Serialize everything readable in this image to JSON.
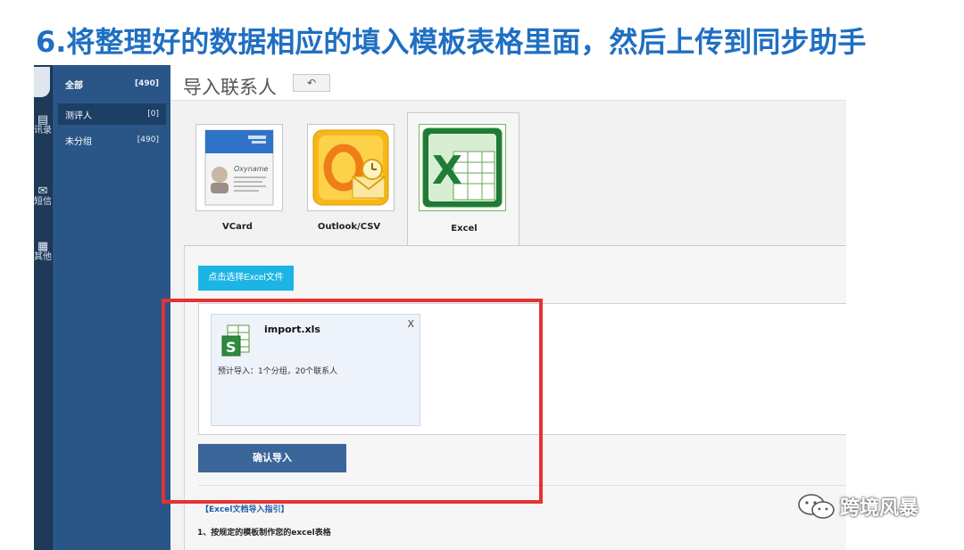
{
  "slide": {
    "title": "6.将整理好的数据相应的填入模板表格里面，然后上传到同步助手"
  },
  "nav": {
    "items": [
      {
        "icon": "contacts-book-icon",
        "label": "讯录"
      },
      {
        "icon": "mail-icon",
        "label": "短信"
      },
      {
        "icon": "grid-icon",
        "label": "其他"
      }
    ]
  },
  "groups": [
    {
      "label": "全部",
      "count": "[490]"
    },
    {
      "label": "测评人",
      "count": "[0]"
    },
    {
      "label": "未分组",
      "count": "[490]"
    }
  ],
  "header": {
    "title": "导入联系人",
    "back_icon": "undo-arrow-icon"
  },
  "tabs": [
    {
      "label": "VCard",
      "icon": "vcard-icon"
    },
    {
      "label": "Outlook/CSV",
      "icon": "outlook-icon"
    },
    {
      "label": "Excel",
      "icon": "excel-icon"
    }
  ],
  "vcard_card_name": "Oxyname",
  "selected_tab": "Excel",
  "content": {
    "choose_button": "点击选择Excel文件",
    "file": {
      "name": "import.xls",
      "close": "X",
      "summary": "预计导入：1个分组，20个联系人"
    },
    "confirm_button": "确认导入",
    "guide_title": "【Excel文档导入指引】",
    "guide_step": "1、按规定的模板制作您的excel表格"
  },
  "watermark": {
    "text": "跨境风暴"
  },
  "colors": {
    "title_blue": "#1f6fc2",
    "sidebar": "#2a5687",
    "choose_button": "#1cb4e4",
    "confirm_button": "#3a6699",
    "highlight": "#e53232"
  }
}
